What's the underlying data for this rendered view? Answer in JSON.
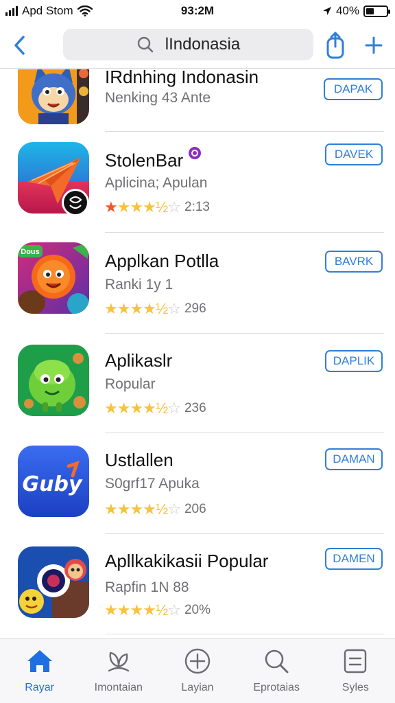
{
  "status_bar": {
    "carrier": "Apd Stom",
    "time": "93:2M",
    "battery": "40%"
  },
  "nav": {
    "search_text": "lIndonasia"
  },
  "apps": [
    {
      "name": "IRdnhing Indonasin",
      "subtitle": "Nenking 43 Ante",
      "rating_text": "",
      "stars": 0,
      "button": "DAPAK"
    },
    {
      "name": "StolenBar",
      "subtitle": "Aplicina; Apulan",
      "rating_text": "2:13",
      "stars": 4.5,
      "button": "DAVEK"
    },
    {
      "name": "Applkan Potlla",
      "subtitle": "Ranki 1y 1",
      "rating_text": "296",
      "stars": 4.5,
      "button": "BAVRK"
    },
    {
      "name": "Aplikaslr",
      "subtitle": "Ropular",
      "rating_text": "236",
      "stars": 4.5,
      "button": "DAPLIK"
    },
    {
      "name": "Ustlallen",
      "subtitle": "S0grf17 Apuka",
      "rating_text": "206",
      "stars": 4.5,
      "button": "DAMAN"
    },
    {
      "name": "Apllkakikasii Popular",
      "subtitle": "Rapfin 1N 88",
      "rating_text": "20%",
      "stars": 4.5,
      "button": "DAMEN"
    }
  ],
  "icon_texts": {
    "app3_badge": "Dous",
    "app5_logo": "Guby"
  },
  "tabs": [
    {
      "label": "Rayar",
      "icon": "home-icon",
      "active": true
    },
    {
      "label": "Imontaian",
      "icon": "plant-icon",
      "active": false
    },
    {
      "label": "Layian",
      "icon": "plus-circle-icon",
      "active": false
    },
    {
      "label": "Eprotaias",
      "icon": "search-icon",
      "active": false
    },
    {
      "label": "Syles",
      "icon": "list-icon",
      "active": false
    }
  ],
  "colors": {
    "accent": "#2f7fd8",
    "active_tab": "#1f6fe0",
    "star": "#f6c33c"
  }
}
